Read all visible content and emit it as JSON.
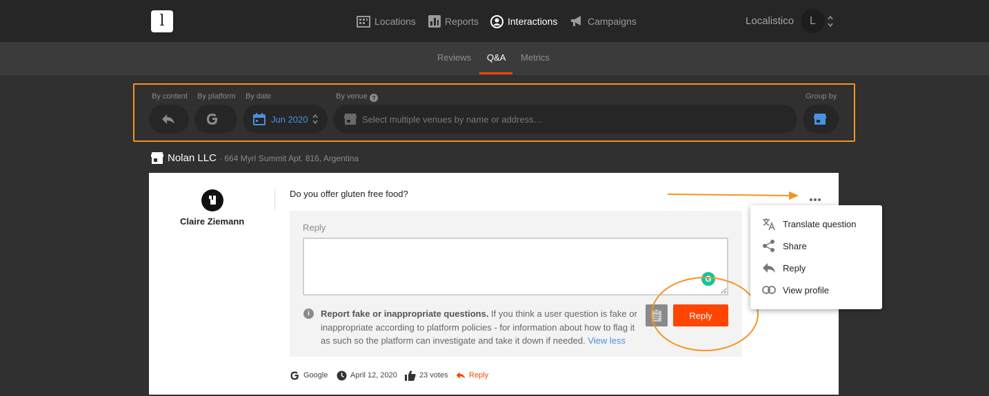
{
  "header": {
    "logo_letter": "l",
    "nav": [
      {
        "label": "Locations",
        "icon": "building-icon"
      },
      {
        "label": "Reports",
        "icon": "bar-chart-icon"
      },
      {
        "label": "Interactions",
        "icon": "user-circle-icon"
      },
      {
        "label": "Campaigns",
        "icon": "megaphone-icon"
      }
    ],
    "active_nav": "Interactions",
    "org_name": "Localistico",
    "avatar_letter": "L"
  },
  "subnav": {
    "tabs": [
      "Reviews",
      "Q&A",
      "Metrics"
    ],
    "active_tab": "Q&A"
  },
  "filters": {
    "by_content_label": "By content",
    "by_platform_label": "By platform",
    "by_date_label": "By date",
    "by_venue_label": "By venue",
    "group_by_label": "Group by",
    "date_value": "Jun 2020",
    "venue_placeholder": "Select multiple venues by name or address…"
  },
  "venue": {
    "name": "Nolan LLC",
    "address": "· 664 Myrl Summit Apt. 816, Argentina"
  },
  "question_card": {
    "author_name": "Claire Ziemann",
    "question": "Do you offer gluten free food?",
    "reply_label": "Reply",
    "notice_bold": "Report fake or inappropriate questions.",
    "notice_text": " If you think a user question is fake or inappropriate according to platform policies - for information about how to flag it as such so the platform can investigate and take it down if needed. ",
    "notice_link": "View less",
    "reply_button": "Reply",
    "grammarly_letter": "G",
    "meta": {
      "platform": "Google",
      "date": "April 12, 2020",
      "votes": "23 votes",
      "reply_link": "Reply"
    }
  },
  "menu": {
    "items": [
      {
        "label": "Translate question",
        "icon": "translate-icon"
      },
      {
        "label": "Share",
        "icon": "share-icon"
      },
      {
        "label": "Reply",
        "icon": "reply-icon"
      },
      {
        "label": "View profile",
        "icon": "link-icon"
      }
    ]
  },
  "colors": {
    "accent": "#ff4500",
    "annotation": "#f7931e",
    "link": "#4a90e2",
    "background": "#303030"
  }
}
